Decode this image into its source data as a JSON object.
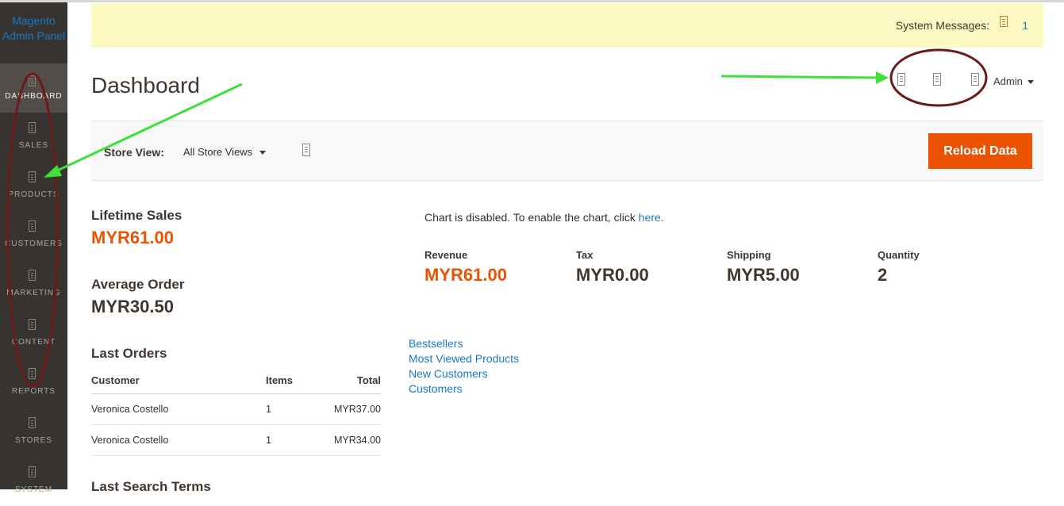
{
  "sidebar": {
    "logo_line1": "Magento",
    "logo_line2": "Admin Panel",
    "items": [
      {
        "label": "DASHBOARD",
        "icon": "dashboard-icon",
        "active": true
      },
      {
        "label": "SALES",
        "icon": "sales-icon"
      },
      {
        "label": "PRODUCTS",
        "icon": "products-icon"
      },
      {
        "label": "CUSTOMERS",
        "icon": "customers-icon"
      },
      {
        "label": "MARKETING",
        "icon": "marketing-icon"
      },
      {
        "label": "CONTENT",
        "icon": "content-icon"
      },
      {
        "label": "REPORTS",
        "icon": "reports-icon"
      },
      {
        "label": "STORES",
        "icon": "stores-icon"
      },
      {
        "label": "SYSTEM",
        "icon": "system-icon"
      }
    ]
  },
  "system_messages": {
    "label": "System Messages:",
    "count": "1"
  },
  "header": {
    "title": "Dashboard",
    "user": "Admin"
  },
  "store_bar": {
    "label": "Store View:",
    "selected": "All Store Views",
    "reload_label": "Reload Data"
  },
  "stats": {
    "lifetime_sales_label": "Lifetime Sales",
    "lifetime_sales_value": "MYR61.00",
    "average_order_label": "Average Order",
    "average_order_value": "MYR30.50"
  },
  "last_orders": {
    "title": "Last Orders",
    "columns": [
      "Customer",
      "Items",
      "Total"
    ],
    "rows": [
      {
        "customer": "Veronica Costello",
        "items": "1",
        "total": "MYR37.00"
      },
      {
        "customer": "Veronica Costello",
        "items": "1",
        "total": "MYR34.00"
      }
    ]
  },
  "last_search": {
    "title": "Last Search Terms"
  },
  "chart": {
    "message": "Chart is disabled. To enable the chart, click ",
    "link": "here."
  },
  "totals": [
    {
      "label": "Revenue",
      "value": "MYR61.00",
      "color": "#eb5202"
    },
    {
      "label": "Tax",
      "value": "MYR0.00",
      "color": "#41362f"
    },
    {
      "label": "Shipping",
      "value": "MYR5.00",
      "color": "#41362f"
    },
    {
      "label": "Quantity",
      "value": "2",
      "color": "#41362f"
    }
  ],
  "tabs": [
    "Bestsellers",
    "Most Viewed Products",
    "New Customers",
    "Customers"
  ],
  "colors": {
    "accent": "#eb5202",
    "link": "#1979c3",
    "sidebar": "#373330",
    "annotation_arrow": "#3ee03a",
    "annotation_circle": "#6b1a1a"
  }
}
